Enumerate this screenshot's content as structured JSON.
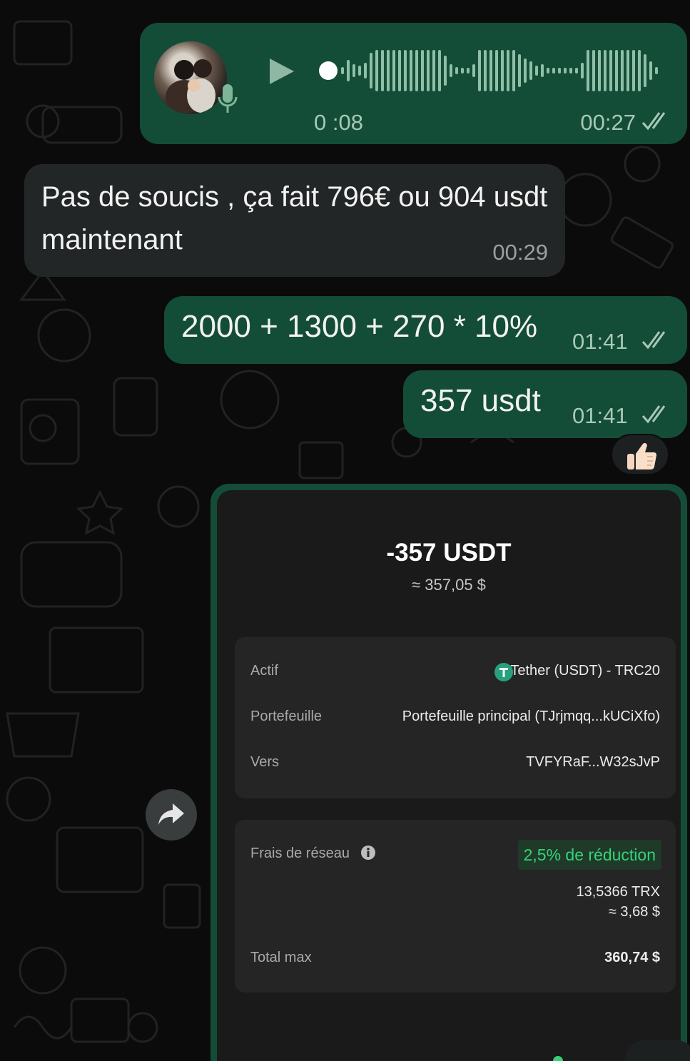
{
  "voice_message": {
    "duration": "0 :08",
    "time": "00:27"
  },
  "incoming_message": {
    "text": "Pas de soucis , ça fait 796€ ou 904 usdt maintenant",
    "time": "00:29"
  },
  "outgoing_messages": [
    {
      "text": "2000 + 1300 + 270 * 10%",
      "time": "01:41"
    },
    {
      "text": "357 usdt",
      "time": "01:41"
    }
  ],
  "reaction": {
    "icon": "thumbs-up-icon"
  },
  "forward_button": {
    "icon": "forward-arrow-icon"
  },
  "transaction": {
    "amount": "-357 USDT",
    "amount_usd": "≈ 357,05 $",
    "details": [
      {
        "label": "Actif",
        "value": "Tether (USDT) - TRC20",
        "icon": "tether-icon"
      },
      {
        "label": "Portefeuille",
        "value": "Portefeuille principal (TJrjmqq...kUCiXfo)"
      },
      {
        "label": "Vers",
        "value": "TVFYRaF...W32sJvP"
      }
    ],
    "fees": {
      "label": "Frais de réseau",
      "discount": "2,5% de réduction",
      "trx": "13,5366 TRX",
      "usd": "≈ 3,68 $"
    },
    "total": {
      "label": "Total max",
      "value": "360,74 $"
    }
  },
  "colors": {
    "background": "#0b0b0b",
    "outgoing_bubble": "#144d37",
    "incoming_bubble": "#232626",
    "accent_green": "#36d27a",
    "tether_green": "#26a17b"
  }
}
